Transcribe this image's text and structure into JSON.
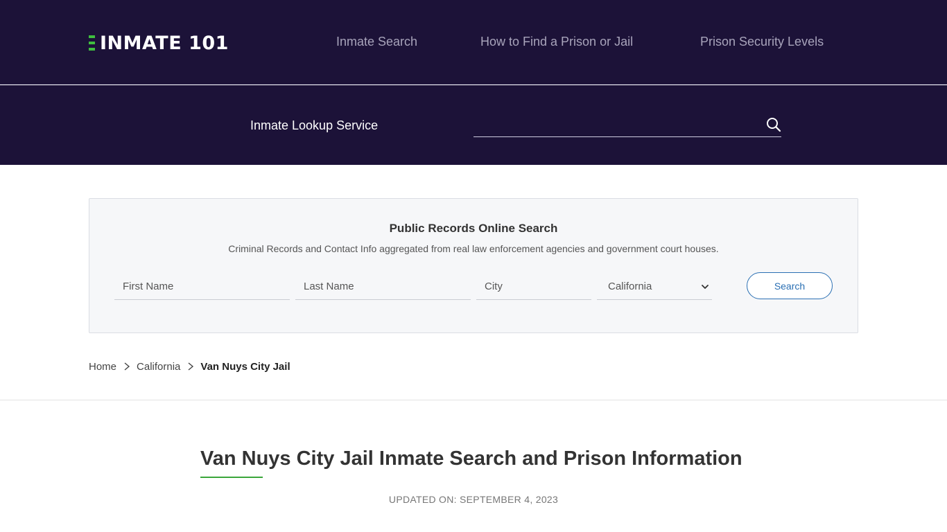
{
  "header": {
    "logo_text": "INMATE 101",
    "nav": [
      "Inmate Search",
      "How to Find a Prison or Jail",
      "Prison Security Levels"
    ]
  },
  "lookup": {
    "label": "Inmate Lookup Service",
    "input_value": "",
    "search_icon": "search-icon"
  },
  "records": {
    "title": "Public Records Online Search",
    "subtitle": "Criminal Records and Contact Info aggregated from real law enforcement agencies and government court houses.",
    "first_name_placeholder": "First Name",
    "last_name_placeholder": "Last Name",
    "city_placeholder": "City",
    "state_selected": "California",
    "search_label": "Search"
  },
  "breadcrumb": [
    "Home",
    "California",
    "Van Nuys City Jail"
  ],
  "main": {
    "title": "Van Nuys City Jail Inmate Search and Prison Information",
    "updated": "UPDATED ON: SEPTEMBER 4, 2023"
  },
  "colors": {
    "header_bg": "#1c1238",
    "accent_green": "#3fbf3f",
    "button_blue": "#2a6fb3"
  }
}
